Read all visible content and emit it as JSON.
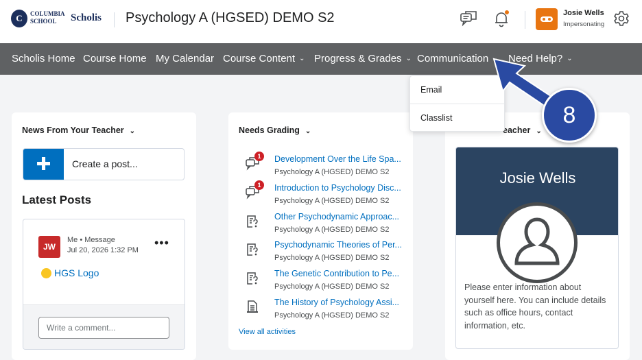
{
  "header": {
    "logo_school": "COLUMBIA SCHOOL",
    "logo_brand": "Scholis",
    "logo_crest": "C",
    "course_title": "Psychology A (HGSED) DEMO S2",
    "user_name": "Josie Wells",
    "user_role": "Impersonating",
    "icons": [
      "chat-icon",
      "bell-icon",
      "gear-icon"
    ]
  },
  "nav": {
    "items": [
      {
        "label": "Scholis Home"
      },
      {
        "label": "Course Home"
      },
      {
        "label": "My Calendar"
      },
      {
        "label": "Course Content"
      },
      {
        "label": "Progress & Grades"
      },
      {
        "label": "Communication"
      },
      {
        "label": "Need Help?"
      }
    ],
    "chevron": "⌄"
  },
  "dropdown": {
    "items": [
      {
        "label": "Email"
      },
      {
        "label": "Classlist"
      }
    ]
  },
  "news": {
    "title": "News From Your Teacher",
    "create_label": "Create a post...",
    "latest_title": "Latest Posts",
    "post": {
      "initials": "JW",
      "meta_author": "Me • Message",
      "meta_date": "Jul 20, 2026 1:32 PM",
      "link_text": "HGS Logo",
      "comment_placeholder": "Write a comment..."
    }
  },
  "grading": {
    "title": "Needs Grading",
    "items": [
      {
        "title": "Development Over the Life Spa...",
        "course": "Psychology A (HGSED) DEMO S2",
        "icon": "discussion-icon",
        "badge": "1"
      },
      {
        "title": "Introduction to Psychology Disc...",
        "course": "Psychology A (HGSED) DEMO S2",
        "icon": "discussion-icon",
        "badge": "1"
      },
      {
        "title": "Other Psychodynamic Approac...",
        "course": "Psychology A (HGSED) DEMO S2",
        "icon": "quiz-icon",
        "badge": ""
      },
      {
        "title": "Psychodynamic Theories of Per...",
        "course": "Psychology A (HGSED) DEMO S2",
        "icon": "quiz-icon",
        "badge": ""
      },
      {
        "title": "The Genetic Contribution to Pe...",
        "course": "Psychology A (HGSED) DEMO S2",
        "icon": "quiz-icon",
        "badge": ""
      },
      {
        "title": "The History of Psychology Assi...",
        "course": "Psychology A (HGSED) DEMO S2",
        "icon": "assignment-icon",
        "badge": ""
      }
    ],
    "view_all": "View all activities"
  },
  "teacher": {
    "title_visible": "eacher",
    "name": "Josie Wells",
    "description": "Please enter information about yourself here. You can include details such as office hours, contact information, etc."
  },
  "annotation": {
    "step": "8"
  },
  "colors": {
    "nav_bg": "#5f6163",
    "link": "#006fbf",
    "accent": "#e87511",
    "badge": "#cd2026",
    "callout": "#2a4aa2",
    "banner": "#2b4461"
  }
}
